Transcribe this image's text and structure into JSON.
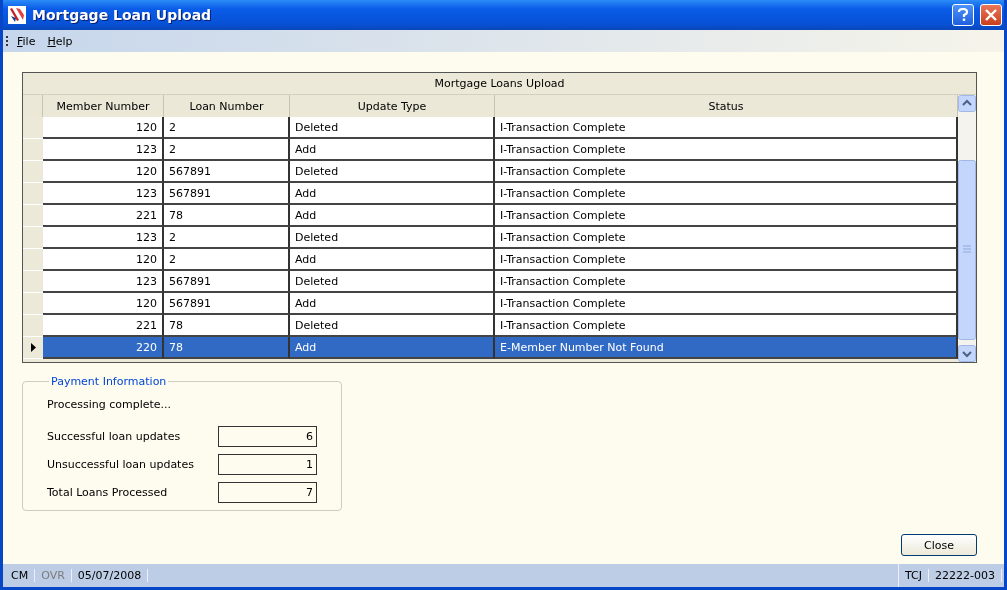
{
  "window": {
    "title": "Mortgage Loan Upload"
  },
  "menu": [
    "File",
    "Help"
  ],
  "grid": {
    "caption": "Mortgage Loans Upload",
    "columns": [
      "Member Number",
      "Loan Number",
      "Update Type",
      "Status"
    ],
    "rows": [
      {
        "cells": [
          "120",
          "2",
          "Deleted",
          "I-Transaction Complete"
        ],
        "selected": false
      },
      {
        "cells": [
          "123",
          "2",
          "Add",
          "I-Transaction Complete"
        ],
        "selected": false
      },
      {
        "cells": [
          "120",
          "567891",
          "Deleted",
          "I-Transaction Complete"
        ],
        "selected": false
      },
      {
        "cells": [
          "123",
          "567891",
          "Add",
          "I-Transaction Complete"
        ],
        "selected": false
      },
      {
        "cells": [
          "221",
          "78",
          "Add",
          "I-Transaction Complete"
        ],
        "selected": false
      },
      {
        "cells": [
          "123",
          "2",
          "Deleted",
          "I-Transaction Complete"
        ],
        "selected": false
      },
      {
        "cells": [
          "120",
          "2",
          "Add",
          "I-Transaction Complete"
        ],
        "selected": false
      },
      {
        "cells": [
          "123",
          "567891",
          "Deleted",
          "I-Transaction Complete"
        ],
        "selected": false
      },
      {
        "cells": [
          "120",
          "567891",
          "Add",
          "I-Transaction Complete"
        ],
        "selected": false
      },
      {
        "cells": [
          "221",
          "78",
          "Deleted",
          "I-Transaction Complete"
        ],
        "selected": false
      },
      {
        "cells": [
          "220",
          "78",
          "Add",
          "E-Member Number Not Found"
        ],
        "selected": true
      }
    ]
  },
  "payment_information": {
    "title": "Payment Information",
    "message": "Processing complete...",
    "fields": [
      {
        "label": "Successful loan updates",
        "value": "6"
      },
      {
        "label": "Unsuccessful loan updates",
        "value": "1"
      },
      {
        "label": "Total Loans Processed",
        "value": "7"
      }
    ]
  },
  "buttons": [
    "Close"
  ],
  "status_bar": [
    {
      "text": "CM",
      "disabled": false
    },
    {
      "text": "OVR",
      "disabled": true
    },
    {
      "text": "05/07/2008",
      "disabled": false
    },
    {
      "text": "TCJ",
      "disabled": false
    },
    {
      "text": "22222-003",
      "disabled": false
    }
  ]
}
